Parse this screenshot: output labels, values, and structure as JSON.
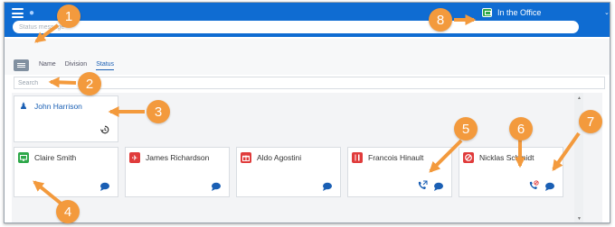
{
  "app": {
    "status_placeholder": "Status message",
    "presence_label": "In the Office",
    "caret": "⌄"
  },
  "toolbar": {
    "tabs": [
      {
        "label": "Name"
      },
      {
        "label": "Division"
      },
      {
        "label": "Status"
      }
    ],
    "active_tab": "Status",
    "search_placeholder": "Search"
  },
  "self_card": {
    "name": "John Harrison",
    "icon": "person-icon",
    "action_icon": "history-icon"
  },
  "cards": [
    {
      "name": "Claire Smith",
      "status": "in-office",
      "status_color": "#2ea84a",
      "icon": "monitor-icon",
      "call": false
    },
    {
      "name": "James Richardson",
      "status": "travel",
      "status_color": "#e03b3b",
      "icon": "airplane-icon",
      "call": false
    },
    {
      "name": "Aldo Agostini",
      "status": "away",
      "status_color": "#e03b3b",
      "icon": "gift-icon",
      "call": false
    },
    {
      "name": "Francois Hinault",
      "status": "meal",
      "status_color": "#e03b3b",
      "icon": "fork-knife-icon",
      "call": true,
      "call_icon": "call-transfer-icon"
    },
    {
      "name": "Nicklas Schmidt",
      "status": "do-not-disturb",
      "status_color": "#e03b3b",
      "icon": "no-entry-icon",
      "call": true,
      "call_icon": "call-blocked-icon"
    }
  ],
  "annotations": [
    "1",
    "2",
    "3",
    "4",
    "5",
    "6",
    "7",
    "8"
  ],
  "colors": {
    "brand": "#0f6cd2",
    "callout": "#f39a3d"
  }
}
